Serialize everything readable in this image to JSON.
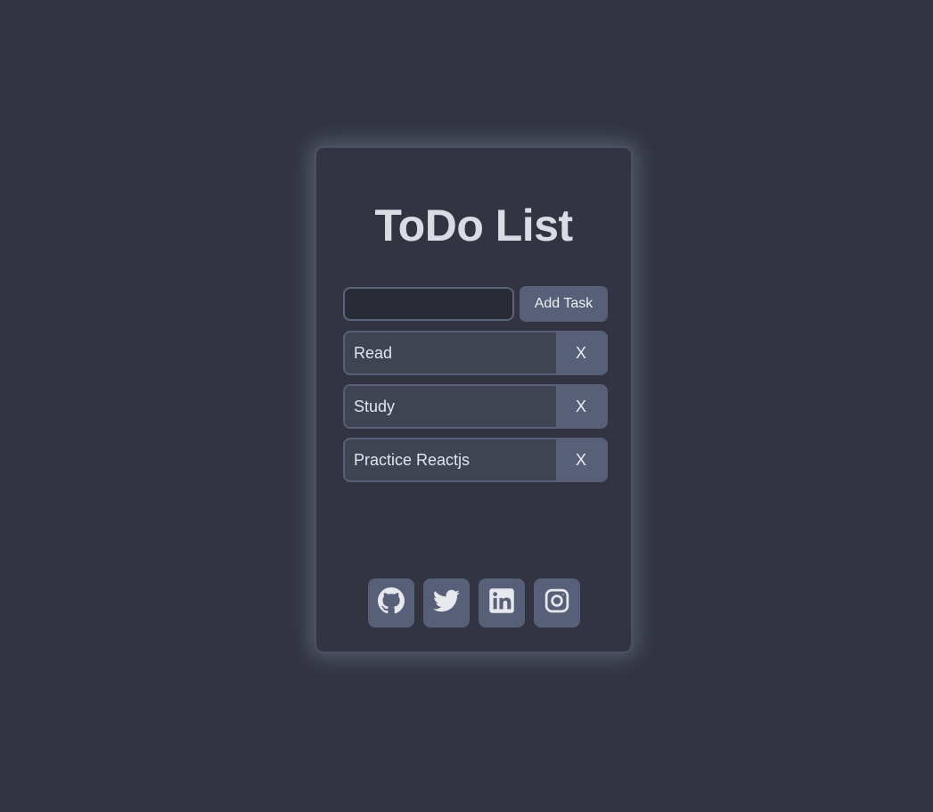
{
  "app": {
    "title": "ToDo List"
  },
  "form": {
    "input_value": "",
    "input_placeholder": "",
    "add_label": "Add Task"
  },
  "tasks": [
    {
      "label": "Read",
      "delete_label": "X"
    },
    {
      "label": "Study",
      "delete_label": "X"
    },
    {
      "label": "Practice Reactjs",
      "delete_label": "X"
    }
  ],
  "socials": [
    {
      "icon": "github-icon"
    },
    {
      "icon": "twitter-icon"
    },
    {
      "icon": "linkedin-icon"
    },
    {
      "icon": "instagram-icon"
    }
  ],
  "colors": {
    "background": "#323541",
    "accent": "#586079",
    "text": "#d9dce3"
  }
}
